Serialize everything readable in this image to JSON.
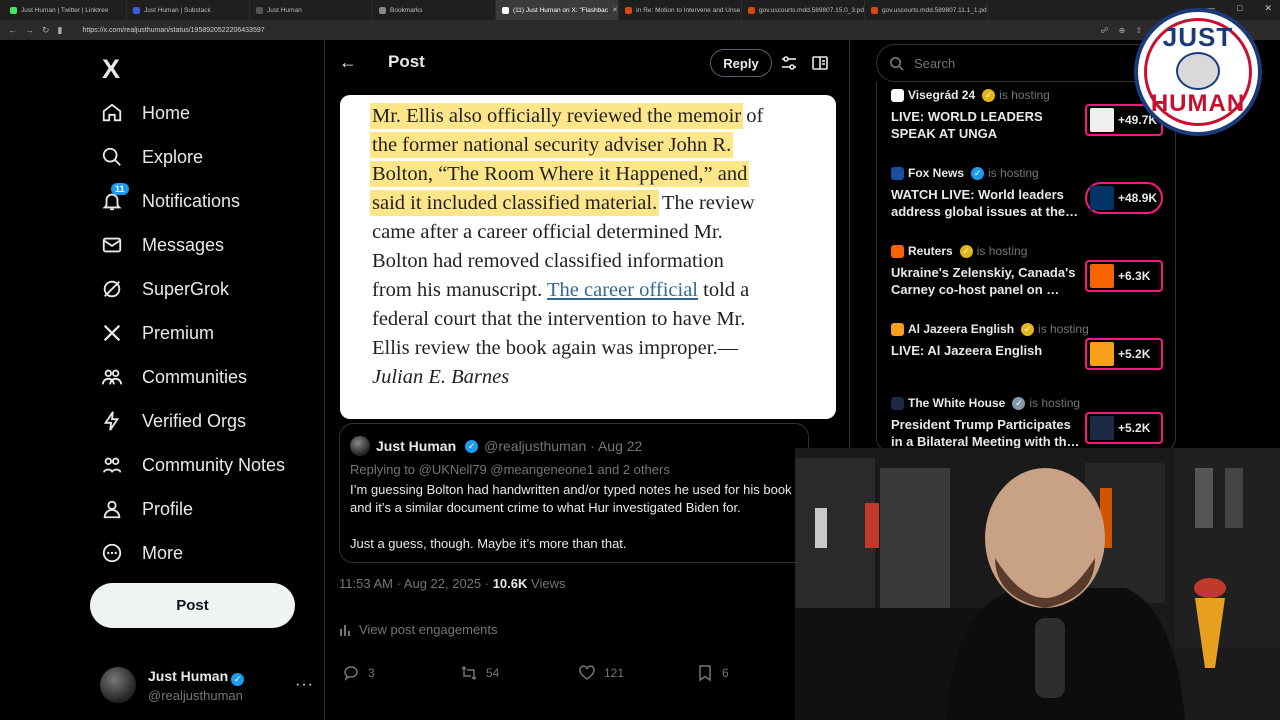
{
  "browser": {
    "tabs": [
      {
        "label": "Just Human | Twitter | Linktree",
        "color": "#43e660"
      },
      {
        "label": "Just Human | Substack",
        "color": "#3b5bdb"
      },
      {
        "label": "Just Human",
        "color": "#555555"
      },
      {
        "label": "Bookmarks",
        "color": "#888888"
      },
      {
        "label": "(11) Just Human on X: \"Flashbac",
        "color": "#ffffff",
        "active": true
      },
      {
        "label": "In Re: Motion to Intervene and Unse",
        "color": "#d9480f"
      },
      {
        "label": "gov.uscourts.mdd.589807.15.0_3.pdf",
        "color": "#d9480f"
      },
      {
        "label": "gov.uscourts.mdd.589807.11.1_1.pdf",
        "color": "#d9480f"
      }
    ],
    "url": "https://x.com/realjusthuman/status/1958920522206433597"
  },
  "nav": {
    "logo": "X",
    "items": [
      {
        "label": "Home",
        "icon": "home-icon"
      },
      {
        "label": "Explore",
        "icon": "search-icon"
      },
      {
        "label": "Notifications",
        "icon": "bell-icon",
        "badge": "11"
      },
      {
        "label": "Messages",
        "icon": "envelope-icon"
      },
      {
        "label": "SuperGrok",
        "icon": "grok-icon"
      },
      {
        "label": "Premium",
        "icon": "x-icon"
      },
      {
        "label": "Communities",
        "icon": "people-icon"
      },
      {
        "label": "Verified Orgs",
        "icon": "lightning-icon"
      },
      {
        "label": "Community Notes",
        "icon": "notes-icon"
      },
      {
        "label": "Profile",
        "icon": "person-icon"
      },
      {
        "label": "More",
        "icon": "more-circle-icon"
      }
    ],
    "post_label": "Post",
    "account": {
      "name": "Just Human",
      "handle": "@realjusthuman"
    }
  },
  "header": {
    "title": "Post",
    "reply_label": "Reply"
  },
  "article": {
    "lines": [
      [
        {
          "t": "Mr. Ellis also officially reviewed the memoir",
          "hl": true
        },
        {
          "t": " of"
        }
      ],
      [
        {
          "t": "the former national security adviser John R.",
          "hl": true
        }
      ],
      [
        {
          "t": "Bolton, “The Room Where it Happened,” and",
          "hl": true
        }
      ],
      [
        {
          "t": "said it included classified material.",
          "hl": true
        },
        {
          "t": " The review"
        }
      ],
      [
        {
          "t": "came after a career official determined Mr."
        }
      ],
      [
        {
          "t": "Bolton had removed classified information"
        }
      ],
      [
        {
          "t": "from his manuscript. "
        },
        {
          "t": "The career official",
          "link": true
        },
        {
          "t": " told a"
        }
      ],
      [
        {
          "t": "federal court that the intervention to have Mr."
        }
      ],
      [
        {
          "t": "Ellis review the book again was improper.—"
        }
      ],
      [
        {
          "t": "Julian E. Barnes",
          "italic": true
        }
      ]
    ]
  },
  "quote": {
    "name": "Just Human",
    "handle_date": "@realjusthuman · Aug 22",
    "replying": "Replying to @UKNell79 @meangeneone1 and 2 others",
    "body": "I’m guessing Bolton had handwritten and/or typed notes he used for his book and it’s a similar document crime to what Hur investigated Biden for.\n\nJust a guess, though. Maybe it’s more than that."
  },
  "post_meta": {
    "time": "11:53 AM · Aug 22, 2025 · ",
    "views": "10.6K",
    "views_label": " Views"
  },
  "engagements_label": "View post engagements",
  "actions": {
    "replies": "3",
    "reposts": "54",
    "likes": "121",
    "bookmarks": "6"
  },
  "search": {
    "placeholder": "Search"
  },
  "live": [
    {
      "host": "Visegrád 24",
      "badge": "gold",
      "hosting": "is hosting",
      "title": "LIVE: WORLD LEADERS SPEAK AT UNGA",
      "count": "+49.7K",
      "icon_color": "#ffffff",
      "thumb_color": "#f0f0f0"
    },
    {
      "host": "Fox News",
      "badge": "blue",
      "hosting": "is hosting",
      "title": "WATCH LIVE: World leaders address global issues at the…",
      "count": "+48.9K",
      "icon_color": "#1a4fa0",
      "thumb_color": "#003366"
    },
    {
      "host": "Reuters",
      "badge": "gold",
      "hosting": "is hosting",
      "title": "Ukraine's Zelenskiy, Canada's Carney co-host panel on …",
      "count": "+6.3K",
      "icon_color": "#fa6400",
      "thumb_color": "#fa6400"
    },
    {
      "host": "Al Jazeera English",
      "badge": "gold",
      "hosting": "is hosting",
      "title": "LIVE: Al Jazeera English",
      "count": "+5.2K",
      "icon_color": "#fa9f1b",
      "thumb_color": "#fa9f1b"
    },
    {
      "host": "The White House",
      "badge": "gray",
      "hosting": "is hosting",
      "title": "President Trump Participates in a Bilateral Meeting with th…",
      "count": "+5.2K",
      "icon_color": "#1d2a44",
      "thumb_color": "#1d2a44"
    }
  ],
  "overlay": {
    "logo_top": "JUST",
    "logo_bottom": "HUMAN"
  },
  "colors": {
    "accent": "#1d9bf0",
    "highlight": "#fde68a",
    "live_border": "#f91880"
  }
}
